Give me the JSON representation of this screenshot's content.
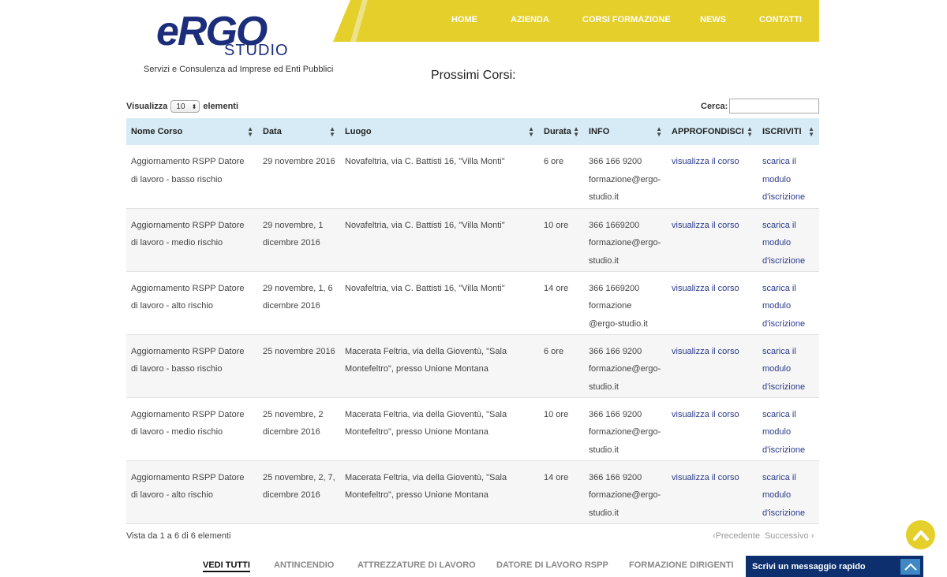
{
  "header": {
    "logo_mark": "eRGO",
    "logo_studio": "STUDIO",
    "tagline": "Servizi e Consulenza ad Imprese ed Enti Pubblici",
    "nav": [
      {
        "label": "HOME"
      },
      {
        "label": "AZIENDA"
      },
      {
        "label": "CORSI FORMAZIONE"
      },
      {
        "label": "NEWS"
      },
      {
        "label": "CONTATTI"
      }
    ]
  },
  "main": {
    "heading": "Prossimi Corsi:",
    "length_prefix": "Visualizza",
    "length_value": "10",
    "length_suffix": "elementi",
    "search_label": "Cerca:",
    "search_value": "",
    "columns": [
      "Nome Corso",
      "Data",
      "Luogo",
      "Durata",
      "INFO",
      "APPROFONDISCI",
      "ISCRIVITI"
    ],
    "rows": [
      {
        "nome": "Aggiornamento RSPP Datore di lavoro - basso rischio",
        "data": "29 novembre 2016",
        "luogo": "Novafeltria, via C. Battisti 16, \"Villa Monti\"",
        "durata": "6 ore",
        "tel": "366 166 9200",
        "email": "formazione@ergo-studio.it",
        "approfondisci": "visualizza il corso",
        "iscriviti": "scarica il modulo d'iscrizione"
      },
      {
        "nome": "Aggiornamento RSPP Datore di lavoro - medio rischio",
        "data": "29 novembre, 1 dicembre 2016",
        "luogo": "Novafeltria, via C. Battisti 16, \"Villa Monti\"",
        "durata": "10 ore",
        "tel": "366 1669200",
        "email": "formazione@ergo-studio.it",
        "approfondisci": "visualizza il corso",
        "iscriviti": "scarica il modulo d'iscrizione"
      },
      {
        "nome": "Aggiornamento RSPP Datore di lavoro - alto rischio",
        "data": "29 novembre, 1, 6 dicembre 2016",
        "luogo": "Novafeltria, via C. Battisti 16, \"Villa Monti\"",
        "durata": "14 ore",
        "tel": "366 1669200",
        "email": "formazione @ergo-studio.it",
        "approfondisci": "visualizza il corso",
        "iscriviti": "scarica il modulo d'iscrizione"
      },
      {
        "nome": "Aggiornamento RSPP Datore di lavoro - basso rischio",
        "data": "25 novembre 2016",
        "luogo": "Macerata Feltria, via della Gioventù, \"Sala Montefeltro\", presso Unione Montana",
        "durata": "6 ore",
        "tel": "366 166 9200",
        "email": "formazione@ergo-studio.it",
        "approfondisci": "visualizza il corso",
        "iscriviti": "scarica il modulo d'iscrizione"
      },
      {
        "nome": "Aggiornamento RSPP Datore di lavoro - medio rischio",
        "data": "25 novembre, 2 dicembre 2016",
        "luogo": "Macerata Feltria, via della Gioventù, \"Sala Montefeltro\", presso Unione Montana",
        "durata": "10 ore",
        "tel": "366 166 9200",
        "email": "formazione@ergo-studio.it",
        "approfondisci": "visualizza il corso",
        "iscriviti": "scarica il modulo d'iscrizione"
      },
      {
        "nome": "Aggiornamento RSPP Datore di lavoro - alto rischio",
        "data": "25 novembre, 2, 7, dicembre 2016",
        "luogo": "Macerata Feltria, via della Gioventù, \"Sala Montefeltro\", presso Unione Montana",
        "durata": "14 ore",
        "tel": "366 166 9200",
        "email": "formazione@ergo-studio.it",
        "approfondisci": "visualizza il corso",
        "iscriviti": "scarica il modulo d'iscrizione"
      }
    ],
    "info": "Vista da 1 a 6 di 6 elementi",
    "pager_prev": "Precedente",
    "pager_next": "Successivo"
  },
  "filters": [
    {
      "label": "VEDI TUTTI",
      "active": true
    },
    {
      "label": "ANTINCENDIO",
      "active": false
    },
    {
      "label": "ATTREZZATURE DI LAVORO",
      "active": false
    },
    {
      "label": "DATORE DI LAVORO RSPP",
      "active": false
    },
    {
      "label": "FORMAZIONE DIRIGENTI",
      "active": false
    }
  ],
  "chat": {
    "label": "Scrivi un messaggio rapido"
  },
  "icons": {
    "scroll_top": "chevron-up-icon",
    "chat_toggle": "chevron-up-icon",
    "sort": "sort-icon"
  },
  "colors": {
    "brand_blue": "#1b2d7b",
    "nav_yellow": "#e5cf2a",
    "table_header": "#d6ebf5",
    "chat_bar": "#0d2f6e"
  }
}
